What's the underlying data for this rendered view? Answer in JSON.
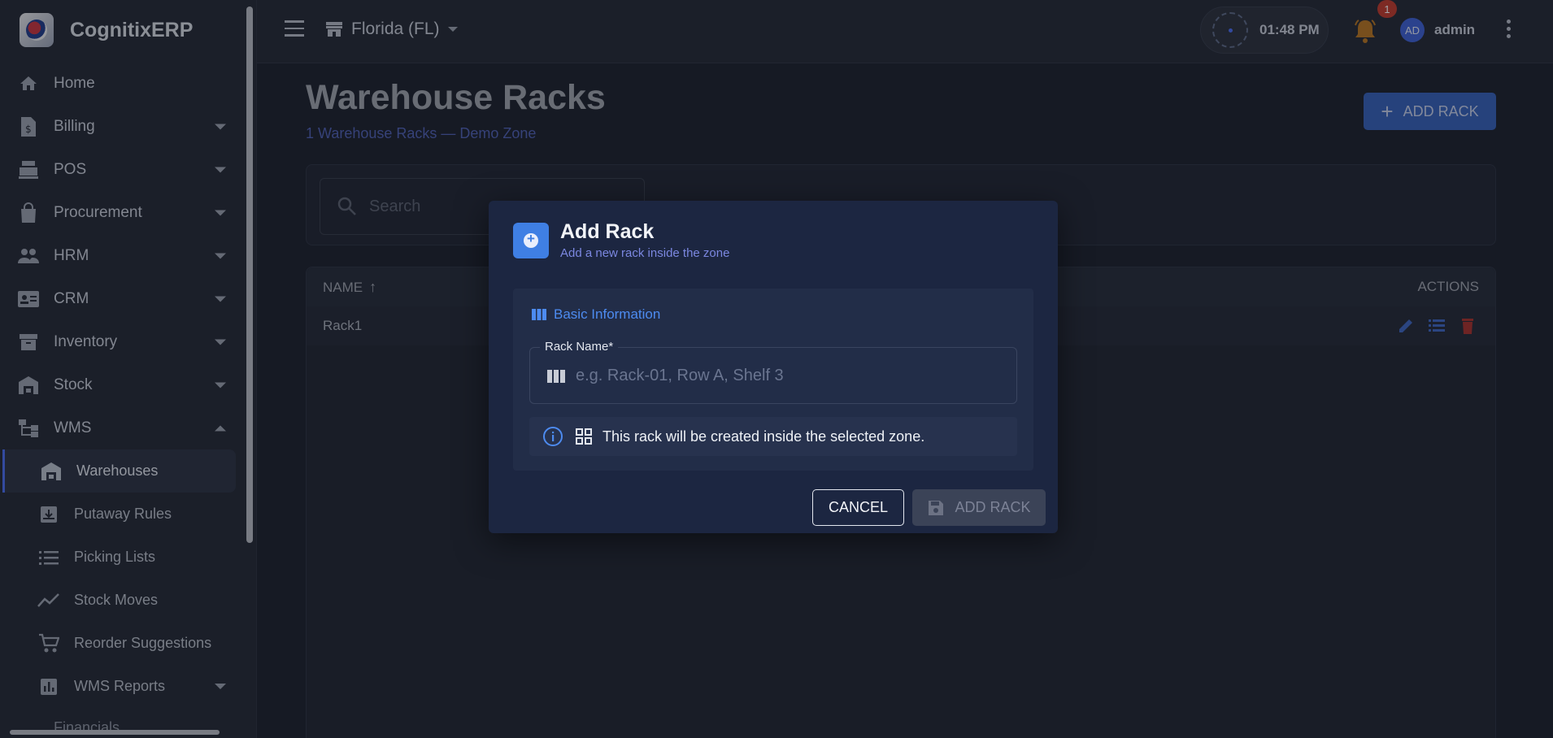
{
  "brand": {
    "name": "CognitixERP"
  },
  "sidebar": {
    "items": [
      {
        "label": "Home",
        "icon": "home-icon"
      },
      {
        "label": "Billing",
        "icon": "billing-icon"
      },
      {
        "label": "POS",
        "icon": "pos-icon"
      },
      {
        "label": "Procurement",
        "icon": "shopping-bag-icon"
      },
      {
        "label": "HRM",
        "icon": "people-icon"
      },
      {
        "label": "CRM",
        "icon": "contact-card-icon"
      },
      {
        "label": "Inventory",
        "icon": "archive-icon"
      },
      {
        "label": "Stock",
        "icon": "warehouse-icon"
      },
      {
        "label": "WMS",
        "icon": "hierarchy-icon"
      }
    ],
    "wms_children": [
      {
        "label": "Warehouses",
        "icon": "warehouse-icon",
        "active": true
      },
      {
        "label": "Putaway Rules",
        "icon": "download-box-icon"
      },
      {
        "label": "Picking Lists",
        "icon": "list-icon"
      },
      {
        "label": "Stock Moves",
        "icon": "trend-line-icon"
      },
      {
        "label": "Reorder Suggestions",
        "icon": "cart-icon"
      },
      {
        "label": "WMS Reports",
        "icon": "bar-chart-icon"
      }
    ],
    "cut_off_label": "Financials"
  },
  "topbar": {
    "store": "Florida (FL)",
    "time": "01:48 PM",
    "notification_count": "1",
    "avatar_initials": "AD",
    "username": "admin"
  },
  "page": {
    "title": "Warehouse Racks",
    "subtitle": "1 Warehouse Racks — Demo Zone",
    "add_button": "ADD RACK",
    "search_placeholder": "Search"
  },
  "table": {
    "headers": {
      "name": "NAME",
      "actions": "ACTIONS"
    },
    "rows": [
      {
        "name": "Rack1"
      }
    ]
  },
  "modal": {
    "title": "Add Rack",
    "subtitle": "Add a new rack inside the zone",
    "section_title": "Basic Information",
    "field_label": "Rack Name*",
    "field_placeholder": "e.g. Rack-01, Row A, Shelf 3",
    "field_value": "",
    "note": "This rack will be created inside the selected zone.",
    "cancel_label": "CANCEL",
    "submit_label": "ADD RACK"
  },
  "colors": {
    "accent": "#3f7fe4",
    "primary_button": "#355fb8",
    "danger": "#c0392b",
    "bell": "#b8741f"
  }
}
